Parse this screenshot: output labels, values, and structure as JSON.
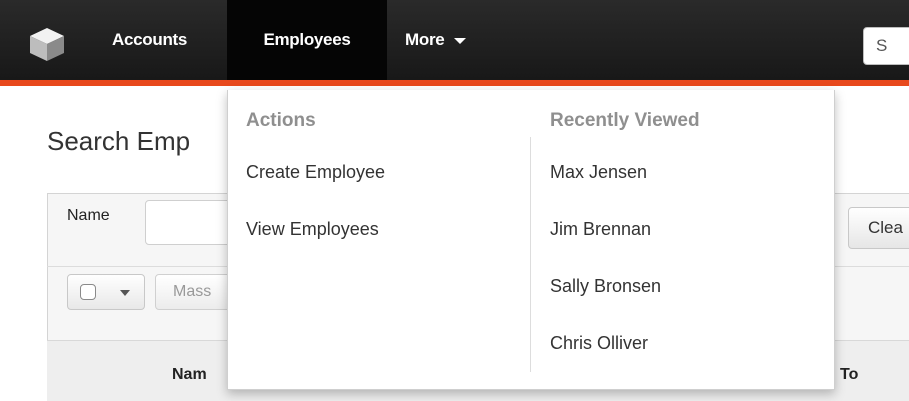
{
  "navbar": {
    "logo_icon": "cube-icon",
    "items": [
      {
        "label": "Accounts"
      },
      {
        "label": "Employees"
      },
      {
        "label": "More"
      }
    ],
    "search_placeholder": "S",
    "accent_color": "#e8491d"
  },
  "page": {
    "title": "Search Emp",
    "filter": {
      "name_label": "Name",
      "name_value": "",
      "clear_label": "Clea"
    },
    "toolbar": {
      "mass_label": "Mass"
    },
    "table": {
      "headers": [
        "Nam",
        "To"
      ]
    }
  },
  "dropdown": {
    "actions": {
      "heading": "Actions",
      "items": [
        {
          "label": "Create Employee"
        },
        {
          "label": "View Employees"
        }
      ]
    },
    "recent": {
      "heading": "Recently Viewed",
      "items": [
        {
          "label": "Max Jensen"
        },
        {
          "label": "Jim Brennan"
        },
        {
          "label": "Sally Bronsen"
        },
        {
          "label": "Chris Olliver"
        }
      ]
    }
  }
}
